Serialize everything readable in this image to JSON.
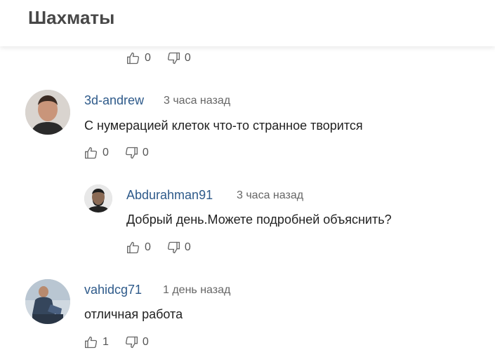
{
  "header": {
    "title": "Шахматы"
  },
  "top_actions": {
    "likes": "0",
    "dislikes": "0"
  },
  "comments": [
    {
      "author": "3d-andrew",
      "time": "3 часа назад",
      "text": "С нумерацией клеток что-то странное творится",
      "likes": "0",
      "dislikes": "0"
    },
    {
      "author": "Abdurahman91",
      "time": "3 часа назад",
      "text": "Добрый день.Можете подробней объяснить?",
      "likes": "0",
      "dislikes": "0"
    },
    {
      "author": "vahidcg71",
      "time": "1 день назад",
      "text": "отличная работа",
      "likes": "1",
      "dislikes": "0"
    }
  ]
}
